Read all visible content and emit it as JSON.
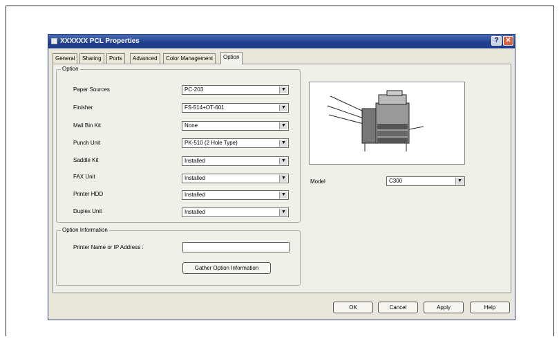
{
  "dialog": {
    "title": "XXXXXX PCL Properties",
    "help_button": "?",
    "close_button": "✕"
  },
  "tabs": [
    "General",
    "Sharing",
    "Ports",
    "Advanced",
    "Color Management",
    "Option"
  ],
  "option_group": {
    "legend": "Option",
    "rows": [
      {
        "label": "Paper Sources",
        "value": "PC-203"
      },
      {
        "label": "Finisher",
        "value": "FS-514+OT-601"
      },
      {
        "label": "Mail Bin Kit",
        "value": "None"
      },
      {
        "label": "Punch Unit",
        "value": "PK-510 (2 Hole Type)"
      },
      {
        "label": "Saddle Kit",
        "value": "Installed"
      },
      {
        "label": "FAX Unit",
        "value": "Installed"
      },
      {
        "label": "Printer HDD",
        "value": "Installed"
      },
      {
        "label": "Duplex Unit",
        "value": "Installed"
      }
    ]
  },
  "option_info_group": {
    "legend": "Option Information",
    "printer_label": "Printer Name or IP Address :",
    "printer_value": "",
    "gather_button": "Gather Option Information"
  },
  "model": {
    "label": "Model",
    "value": "C300"
  },
  "footer": {
    "ok": "OK",
    "cancel": "Cancel",
    "apply": "Apply",
    "help": "Help"
  },
  "colors": {
    "titlebar": "#22418f",
    "dialog_bg": "#e9e7dc"
  }
}
